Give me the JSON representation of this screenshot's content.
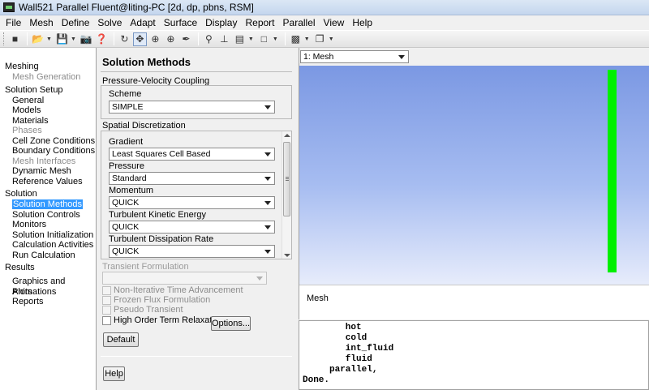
{
  "window": {
    "title": "Wall521 Parallel Fluent@liting-PC  [2d, dp, pbns, RSM]"
  },
  "menu": [
    "File",
    "Mesh",
    "Define",
    "Solve",
    "Adapt",
    "Surface",
    "Display",
    "Report",
    "Parallel",
    "View",
    "Help"
  ],
  "navigation": {
    "sections": [
      {
        "label": "Meshing",
        "items": [
          {
            "label": "Mesh Generation",
            "state": "disabled"
          }
        ]
      },
      {
        "label": "Solution Setup",
        "items": [
          {
            "label": "General",
            "state": "normal"
          },
          {
            "label": "Models",
            "state": "normal"
          },
          {
            "label": "Materials",
            "state": "normal"
          },
          {
            "label": "Phases",
            "state": "disabled"
          },
          {
            "label": "Cell Zone Conditions",
            "state": "normal"
          },
          {
            "label": "Boundary Conditions",
            "state": "normal"
          },
          {
            "label": "Mesh Interfaces",
            "state": "disabled"
          },
          {
            "label": "Dynamic Mesh",
            "state": "normal"
          },
          {
            "label": "Reference Values",
            "state": "normal"
          }
        ]
      },
      {
        "label": "Solution",
        "items": [
          {
            "label": "Solution Methods",
            "state": "selected"
          },
          {
            "label": "Solution Controls",
            "state": "normal"
          },
          {
            "label": "Monitors",
            "state": "normal"
          },
          {
            "label": "Solution Initialization",
            "state": "normal"
          },
          {
            "label": "Calculation Activities",
            "state": "normal"
          },
          {
            "label": "Run Calculation",
            "state": "normal"
          }
        ]
      },
      {
        "label": "Results",
        "items": [
          {
            "label": "Graphics and Animations",
            "state": "normal"
          },
          {
            "label": "Plots",
            "state": "normal"
          },
          {
            "label": "Reports",
            "state": "normal"
          }
        ]
      }
    ]
  },
  "task": {
    "title": "Solution Methods",
    "pv_coupling": {
      "label": "Pressure-Velocity Coupling",
      "scheme_label": "Scheme",
      "scheme_value": "SIMPLE"
    },
    "spatial": {
      "label": "Spatial Discretization",
      "fields": [
        {
          "label": "Gradient",
          "value": "Least Squares Cell Based"
        },
        {
          "label": "Pressure",
          "value": "Standard"
        },
        {
          "label": "Momentum",
          "value": "QUICK"
        },
        {
          "label": "Turbulent Kinetic Energy",
          "value": "QUICK"
        },
        {
          "label": "Turbulent Dissipation Rate",
          "value": "QUICK"
        }
      ]
    },
    "transient": {
      "label": "Transient Formulation",
      "value": ""
    },
    "checkboxes": [
      {
        "label": "Non-Iterative Time Advancement",
        "enabled": false
      },
      {
        "label": "Frozen Flux Formulation",
        "enabled": false
      },
      {
        "label": "Pseudo Transient",
        "enabled": false
      },
      {
        "label": "High Order Term Relaxation",
        "enabled": true
      }
    ],
    "options_button": "Options...",
    "default_button": "Default",
    "help_button": "Help"
  },
  "graphics": {
    "window_select": "1: Mesh",
    "caption": "Mesh",
    "mesh_color": "#00f000"
  },
  "console": {
    "lines": [
      "        hot",
      "        cold",
      "        int_fluid",
      "        fluid",
      "     parallel,",
      "Done."
    ]
  }
}
